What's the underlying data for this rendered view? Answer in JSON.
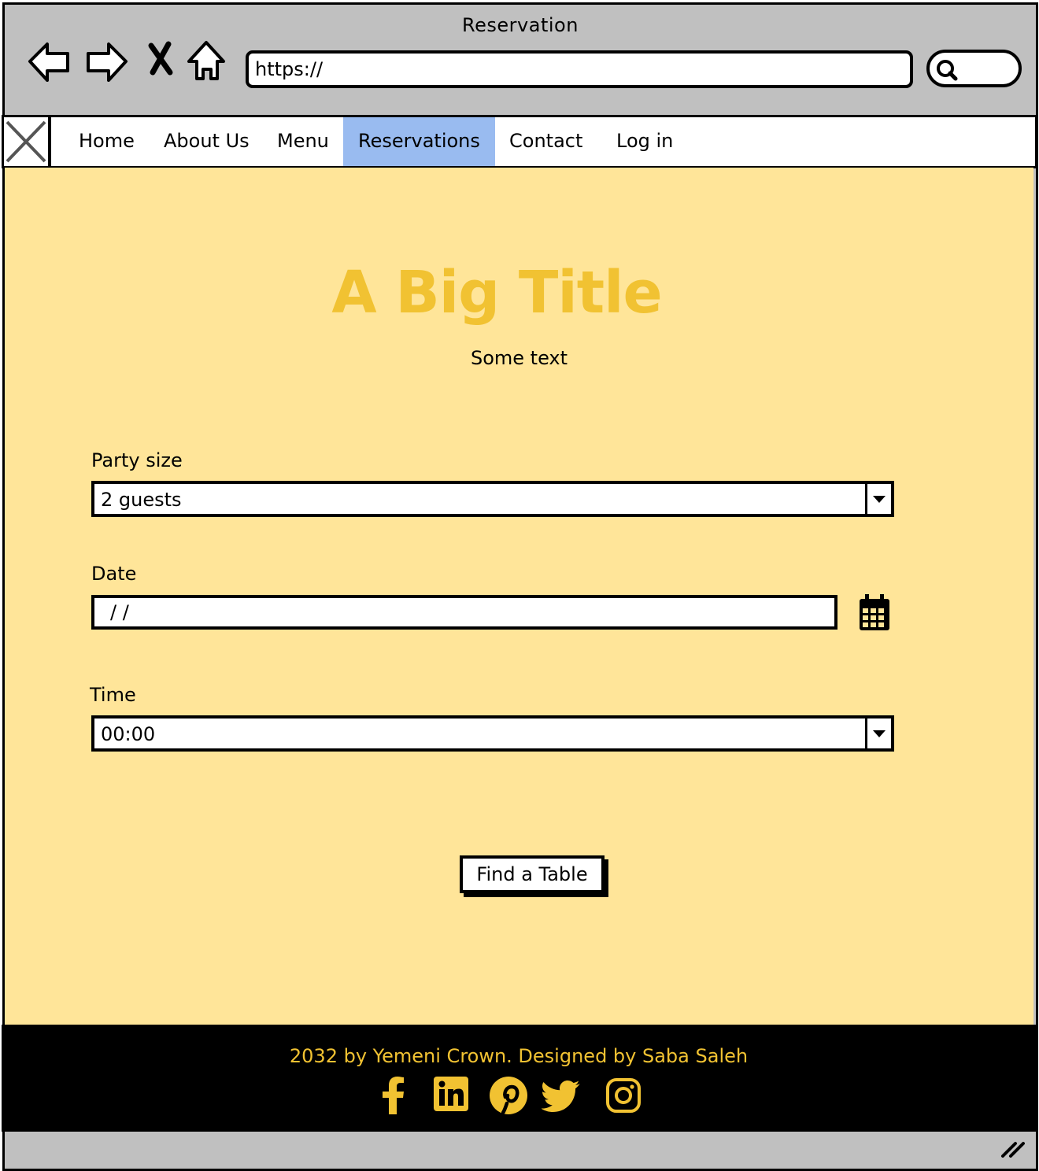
{
  "window": {
    "title": "Reservation",
    "url": "https://"
  },
  "toolbar": {
    "icons": [
      "back-arrow-icon",
      "forward-arrow-icon",
      "stop-icon",
      "home-icon",
      "search-icon"
    ]
  },
  "navbar": {
    "items": [
      {
        "label": "Home"
      },
      {
        "label": "About Us"
      },
      {
        "label": "Menu"
      },
      {
        "label": "Reservations",
        "active": true
      },
      {
        "label": "Contact"
      },
      {
        "label": "Log in"
      }
    ]
  },
  "hero": {
    "title": "A Big Title",
    "subtitle": "Some text"
  },
  "form": {
    "party_label": "Party size",
    "party_value": "2 guests",
    "date_label": "Date",
    "date_value": "/  /",
    "time_label": "Time",
    "time_value": "00:00",
    "submit_label": "Find a Table"
  },
  "footer": {
    "text": "2032 by Yemeni Crown. Designed by Saba Saleh",
    "social_icons": [
      "facebook-icon",
      "linkedin-icon",
      "pinterest-icon",
      "twitter-icon",
      "instagram-icon"
    ]
  },
  "colors": {
    "content_bg": "#ffe599",
    "accent": "#f1c232",
    "active_nav": "#99bbf0",
    "chrome": "#c0c0c0",
    "footer_bg": "#000000"
  }
}
